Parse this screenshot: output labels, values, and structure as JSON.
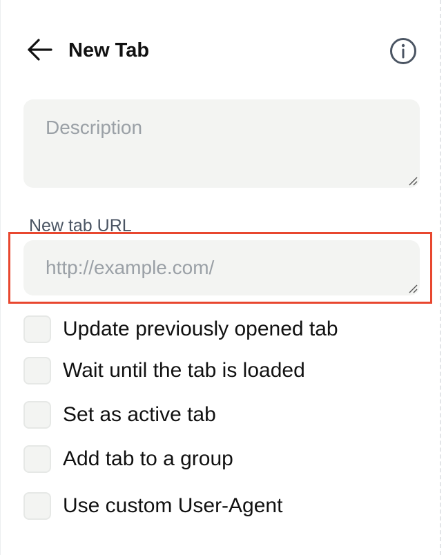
{
  "header": {
    "title": "New Tab",
    "back_icon": "arrow-left-icon",
    "info_icon": "info-circle-icon"
  },
  "description": {
    "placeholder": "Description",
    "value": ""
  },
  "url": {
    "label": "New tab URL",
    "placeholder": "http://example.com/",
    "value": ""
  },
  "options": [
    {
      "label": "Update previously opened tab",
      "checked": false
    },
    {
      "label": "Wait until the tab is loaded",
      "checked": false
    },
    {
      "label": "Set as active tab",
      "checked": false
    },
    {
      "label": "Add tab to a group",
      "checked": false
    },
    {
      "label": "Use custom User-Agent",
      "checked": false
    }
  ],
  "colors": {
    "highlight": "#e8472f",
    "field_bg": "#f3f4f2",
    "placeholder": "#9aa0a6"
  }
}
